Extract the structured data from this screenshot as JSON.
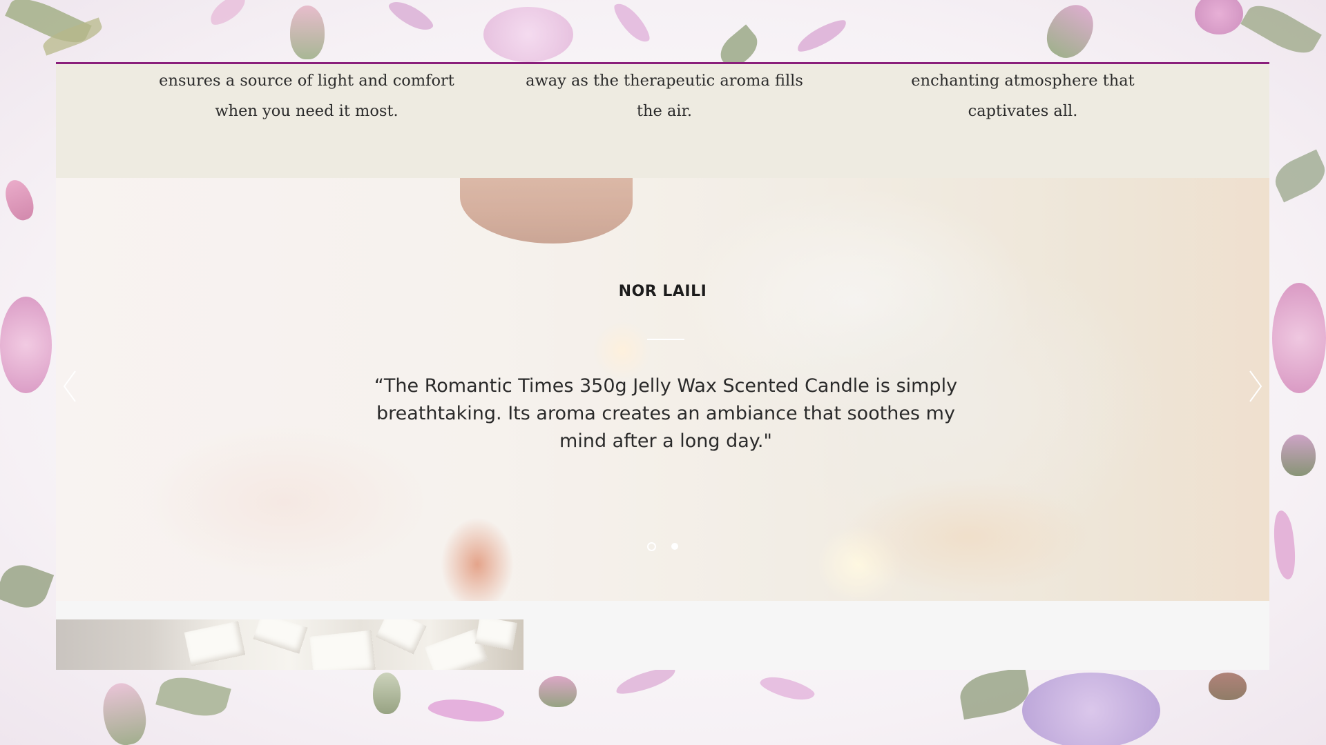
{
  "features": [
    {
      "text": "ensures a source of light and comfort when you need it most."
    },
    {
      "text": "away as the therapeutic aroma fills the air."
    },
    {
      "text": "enchanting atmosphere that captivates all."
    }
  ],
  "testimonial": {
    "name": "NOR LAILI",
    "quote": "“The Romantic Times 350g Jelly Wax Scented Candle is simply breathtaking. Its aroma creates an ambiance that soothes my mind after a long day.\"",
    "arrows": {
      "prev_icon": "chevron-left-icon",
      "next_icon": "chevron-right-icon"
    },
    "slides_total": 2,
    "active_slide": 1
  },
  "colors": {
    "accent": "#8a1f7b",
    "features_bg": "#eeebe1",
    "bottom_bg": "#f6f6f6"
  }
}
